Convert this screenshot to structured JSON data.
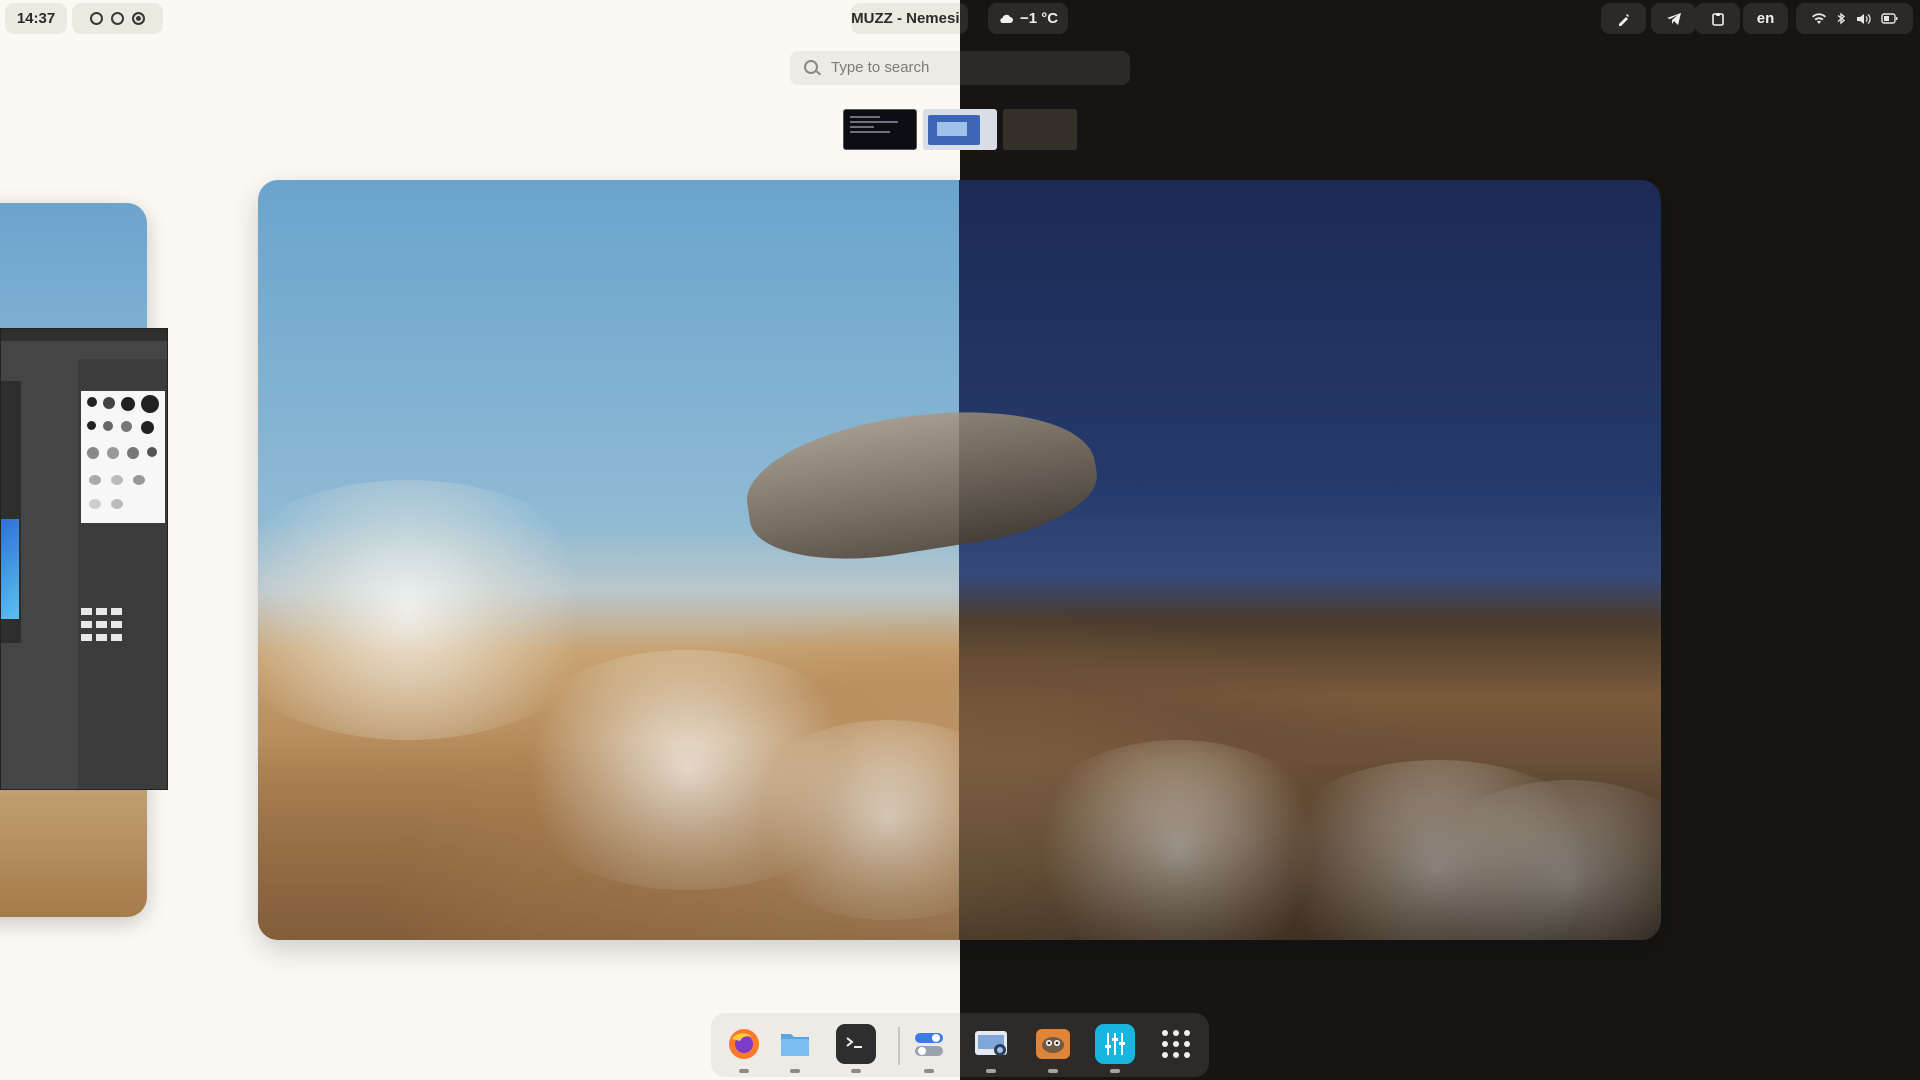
{
  "topbar": {
    "clock": "14:37",
    "workspaces": [
      false,
      false,
      true
    ],
    "media_title": "MUZZ - Nemesis",
    "weather": "−1 °C",
    "sys_buttons": [
      "color-picker-icon",
      "telegram-icon",
      "clipboard-icon"
    ],
    "language": "en",
    "tray_icons": [
      "wifi-icon",
      "bluetooth-icon",
      "volume-icon",
      "battery-icon"
    ]
  },
  "search": {
    "placeholder": "Type to search"
  },
  "workspace_thumbnails": [
    "workspace-1",
    "workspace-2",
    "workspace-3"
  ],
  "dock": {
    "apps": [
      {
        "name": "firefox-icon",
        "color": "#ff7a2b",
        "running": true
      },
      {
        "name": "files-icon",
        "color": "#5aa5e0",
        "running": true
      },
      {
        "name": "terminal-icon",
        "color": "#2e2e2e",
        "running": true
      },
      {
        "name": "tweaks-icon",
        "color": "#3b7be8",
        "running": true
      },
      {
        "name": "screenshot-icon",
        "color": "#7fa8d8",
        "running": true
      },
      {
        "name": "gimp-icon",
        "color": "#e0843a",
        "running": true
      },
      {
        "name": "equalizer-icon",
        "color": "#16b6e0",
        "running": true
      },
      {
        "name": "app-grid-icon",
        "color": "#f1f0ed",
        "running": false
      }
    ]
  },
  "colors": {
    "light_bg": "#fbf9f4",
    "dark_bg": "#161514",
    "accent": "#16b6e0"
  }
}
